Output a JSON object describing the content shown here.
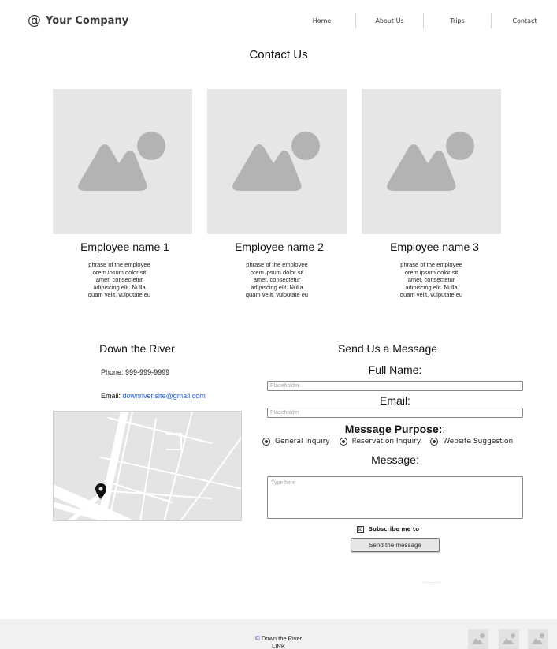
{
  "header": {
    "logo_symbol": "@",
    "company_name": "Your Company",
    "nav": [
      "Home",
      "About Us",
      "Trips",
      "Contact"
    ]
  },
  "page_title": "Contact Us",
  "employees": [
    {
      "name": "Employee name 1",
      "desc": [
        "phrase of the employee",
        "orem ipsum dolor sit",
        "amet, consectetur",
        "adipiscing elit. Nulla",
        "quam velit, vulputate eu"
      ]
    },
    {
      "name": "Employee name 2",
      "desc": [
        "phrase of the employee",
        "orem ipsum dolor sit",
        "amet, consectetur",
        "adipiscing elit. Nulla",
        "quam velit, vulputate eu"
      ]
    },
    {
      "name": "Employee name 3",
      "desc": [
        "phrase of the employee",
        "orem ipsum dolor sit",
        "amet, consectetur",
        "adipiscing elit. Nulla",
        "quam velit, vulputate eu"
      ]
    }
  ],
  "contact": {
    "title": "Down the River",
    "phone_label": "Phone:",
    "phone": "999-999-9999",
    "email_label": "Email:",
    "email": "downriver.site@gmail.com"
  },
  "form": {
    "title": "Send Us a Message",
    "full_name_label": "Full Name:",
    "full_name_placeholder": "Placeholder",
    "email_label": "Email:",
    "email_placeholder": "Placeholder",
    "purpose_label": "Message Purpose:",
    "purpose_suffix": ":",
    "purposes": [
      "General Inquiry",
      "Reservation Inquiry",
      "Website Suggestion"
    ],
    "message_label": "Message:",
    "message_placeholder": "Type here",
    "subscribe_check": "☑",
    "subscribe_label": "Subscribe me to the",
    "send_label": "Send the message"
  },
  "footer": {
    "copyright_symbol": "©",
    "copyright_text": "Down the River",
    "link": "LINK"
  },
  "colors": {
    "link_blue": "#1a5fd0",
    "placeholder_grey": "#e6e6e6",
    "footer_bg": "#f1f1f1",
    "copyright_purple": "#5b3fb4"
  },
  "icons": [
    "at-icon",
    "image-placeholder-icon",
    "map-pin-icon",
    "checkbox-checked-icon"
  ]
}
